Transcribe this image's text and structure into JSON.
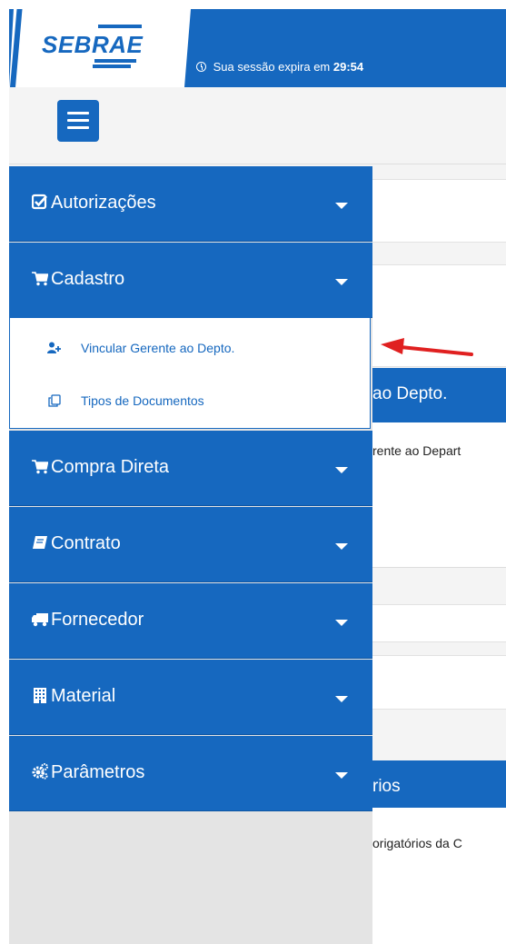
{
  "header": {
    "logo_text": "SEBRAE",
    "session_prefix": "Sua sessão expira em",
    "session_time": "29:54",
    "menu_toggle_icon": "hamburger-icon"
  },
  "background": {
    "panel1_title": "ao Depto.",
    "panel1_text": "rente ao Depart",
    "panel2_title": "rios",
    "panel2_text": "origatórios da C"
  },
  "sidebar": {
    "items": [
      {
        "label": "Autorizações",
        "icon": "checkbox-icon"
      },
      {
        "label": "Cadastro",
        "icon": "cart-icon"
      },
      {
        "label": "Compra Direta",
        "icon": "cart-icon"
      },
      {
        "label": "Contrato",
        "icon": "book-icon"
      },
      {
        "label": "Fornecedor",
        "icon": "truck-icon"
      },
      {
        "label": "Material",
        "icon": "building-icon"
      },
      {
        "label": "Parâmetros",
        "icon": "cogs-icon"
      }
    ],
    "submenu": [
      {
        "label": "Vincular Gerente ao Depto.",
        "icon": "user-plus-icon"
      },
      {
        "label": "Tipos de Documentos",
        "icon": "copy-icon"
      }
    ]
  },
  "colors": {
    "primary": "#1668bf",
    "annotation_arrow": "#e02020"
  }
}
